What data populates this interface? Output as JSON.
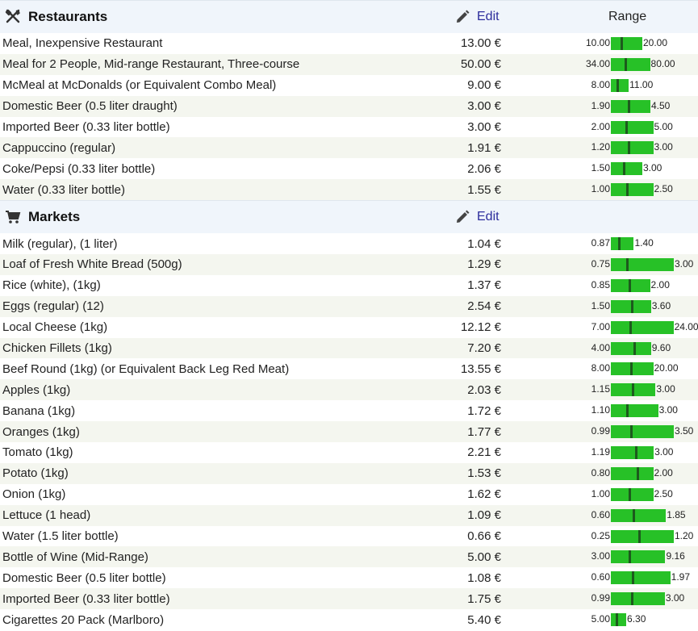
{
  "currency": "€",
  "sections": [
    {
      "title": "Restaurants",
      "icon": "fork-knife-icon",
      "edit_label": "Edit",
      "range_label": "Range",
      "items": [
        {
          "name": "Meal, Inexpensive Restaurant",
          "price": "13.00 €",
          "low": "10.00",
          "high": "20.00",
          "lo_val": 10.0,
          "hi_val": 20.0,
          "avg": 13.0
        },
        {
          "name": "Meal for 2 People, Mid-range Restaurant, Three-course",
          "price": "50.00 €",
          "low": "34.00",
          "high": "80.00",
          "lo_val": 34.0,
          "hi_val": 80.0,
          "avg": 50.0
        },
        {
          "name": "McMeal at McDonalds (or Equivalent Combo Meal)",
          "price": "9.00 €",
          "low": "8.00",
          "high": "11.00",
          "lo_val": 8.0,
          "hi_val": 11.0,
          "avg": 9.0
        },
        {
          "name": "Domestic Beer (0.5 liter draught)",
          "price": "3.00 €",
          "low": "1.90",
          "high": "4.50",
          "lo_val": 1.9,
          "hi_val": 4.5,
          "avg": 3.0
        },
        {
          "name": "Imported Beer (0.33 liter bottle)",
          "price": "3.00 €",
          "low": "2.00",
          "high": "5.00",
          "lo_val": 2.0,
          "hi_val": 5.0,
          "avg": 3.0
        },
        {
          "name": "Cappuccino (regular)",
          "price": "1.91 €",
          "low": "1.20",
          "high": "3.00",
          "lo_val": 1.2,
          "hi_val": 3.0,
          "avg": 1.91
        },
        {
          "name": "Coke/Pepsi (0.33 liter bottle)",
          "price": "2.06 €",
          "low": "1.50",
          "high": "3.00",
          "lo_val": 1.5,
          "hi_val": 3.0,
          "avg": 2.06
        },
        {
          "name": "Water (0.33 liter bottle)",
          "price": "1.55 €",
          "low": "1.00",
          "high": "2.50",
          "lo_val": 1.0,
          "hi_val": 2.5,
          "avg": 1.55
        }
      ]
    },
    {
      "title": "Markets",
      "icon": "shopping-cart-icon",
      "edit_label": "Edit",
      "range_label": "",
      "items": [
        {
          "name": "Milk (regular), (1 liter)",
          "price": "1.04 €",
          "low": "0.87",
          "high": "1.40",
          "lo_val": 0.87,
          "hi_val": 1.4,
          "avg": 1.04
        },
        {
          "name": "Loaf of Fresh White Bread (500g)",
          "price": "1.29 €",
          "low": "0.75",
          "high": "3.00",
          "lo_val": 0.75,
          "hi_val": 3.0,
          "avg": 1.29
        },
        {
          "name": "Rice (white), (1kg)",
          "price": "1.37 €",
          "low": "0.85",
          "high": "2.00",
          "lo_val": 0.85,
          "hi_val": 2.0,
          "avg": 1.37
        },
        {
          "name": "Eggs (regular) (12)",
          "price": "2.54 €",
          "low": "1.50",
          "high": "3.60",
          "lo_val": 1.5,
          "hi_val": 3.6,
          "avg": 2.54
        },
        {
          "name": "Local Cheese (1kg)",
          "price": "12.12 €",
          "low": "7.00",
          "high": "24.00",
          "lo_val": 7.0,
          "hi_val": 24.0,
          "avg": 12.12
        },
        {
          "name": "Chicken Fillets (1kg)",
          "price": "7.20 €",
          "low": "4.00",
          "high": "9.60",
          "lo_val": 4.0,
          "hi_val": 9.6,
          "avg": 7.2
        },
        {
          "name": "Beef Round (1kg) (or Equivalent Back Leg Red Meat)",
          "price": "13.55 €",
          "low": "8.00",
          "high": "20.00",
          "lo_val": 8.0,
          "hi_val": 20.0,
          "avg": 13.55
        },
        {
          "name": "Apples (1kg)",
          "price": "2.03 €",
          "low": "1.15",
          "high": "3.00",
          "lo_val": 1.15,
          "hi_val": 3.0,
          "avg": 2.03
        },
        {
          "name": "Banana (1kg)",
          "price": "1.72 €",
          "low": "1.10",
          "high": "3.00",
          "lo_val": 1.1,
          "hi_val": 3.0,
          "avg": 1.72
        },
        {
          "name": "Oranges (1kg)",
          "price": "1.77 €",
          "low": "0.99",
          "high": "3.50",
          "lo_val": 0.99,
          "hi_val": 3.5,
          "avg": 1.77
        },
        {
          "name": "Tomato (1kg)",
          "price": "2.21 €",
          "low": "1.19",
          "high": "3.00",
          "lo_val": 1.19,
          "hi_val": 3.0,
          "avg": 2.21
        },
        {
          "name": "Potato (1kg)",
          "price": "1.53 €",
          "low": "0.80",
          "high": "2.00",
          "lo_val": 0.8,
          "hi_val": 2.0,
          "avg": 1.53
        },
        {
          "name": "Onion (1kg)",
          "price": "1.62 €",
          "low": "1.00",
          "high": "2.50",
          "lo_val": 1.0,
          "hi_val": 2.5,
          "avg": 1.62
        },
        {
          "name": "Lettuce (1 head)",
          "price": "1.09 €",
          "low": "0.60",
          "high": "1.85",
          "lo_val": 0.6,
          "hi_val": 1.85,
          "avg": 1.09
        },
        {
          "name": "Water (1.5 liter bottle)",
          "price": "0.66 €",
          "low": "0.25",
          "high": "1.20",
          "lo_val": 0.25,
          "hi_val": 1.2,
          "avg": 0.66
        },
        {
          "name": "Bottle of Wine (Mid-Range)",
          "price": "5.00 €",
          "low": "3.00",
          "high": "9.16",
          "lo_val": 3.0,
          "hi_val": 9.16,
          "avg": 5.0
        },
        {
          "name": "Domestic Beer (0.5 liter bottle)",
          "price": "1.08 €",
          "low": "0.60",
          "high": "1.97",
          "lo_val": 0.6,
          "hi_val": 1.97,
          "avg": 1.08
        },
        {
          "name": "Imported Beer (0.33 liter bottle)",
          "price": "1.75 €",
          "low": "0.99",
          "high": "3.00",
          "lo_val": 0.99,
          "hi_val": 3.0,
          "avg": 1.75
        },
        {
          "name": "Cigarettes 20 Pack (Marlboro)",
          "price": "5.40 €",
          "low": "5.00",
          "high": "6.30",
          "lo_val": 5.0,
          "hi_val": 6.3,
          "avg": 5.4
        }
      ]
    }
  ],
  "colors": {
    "bar": "#27c127",
    "marker": "#1d5a1d",
    "header_bg": "#f0f5fb",
    "alt_row": "#f4f6ef",
    "edit": "#2c2c9c"
  }
}
